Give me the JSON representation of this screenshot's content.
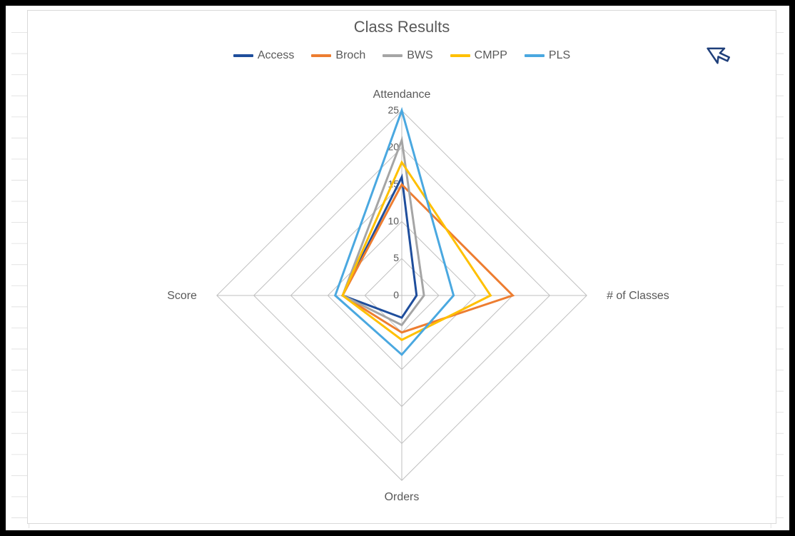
{
  "chart_data": {
    "type": "radar",
    "title": "Class Results",
    "categories": [
      "Attendance",
      "# of Classes",
      "Orders",
      "Score"
    ],
    "axis": {
      "min": 0,
      "max": 25,
      "step": 5,
      "ticks": [
        0,
        5,
        10,
        15,
        20,
        25
      ]
    },
    "series": [
      {
        "name": "Access",
        "color": "#1f4e9c",
        "values": [
          16,
          2,
          3,
          8
        ]
      },
      {
        "name": "Broch",
        "color": "#ed7d31",
        "values": [
          15,
          15,
          5,
          8
        ]
      },
      {
        "name": "BWS",
        "color": "#a5a5a5",
        "values": [
          21,
          3,
          4,
          8
        ]
      },
      {
        "name": "CMPP",
        "color": "#ffc000",
        "values": [
          18,
          12,
          6,
          8
        ]
      },
      {
        "name": "PLS",
        "color": "#4aa8e0",
        "values": [
          25,
          7,
          8,
          9
        ]
      }
    ]
  },
  "cursor": {
    "icon": "cursor-arrow"
  }
}
